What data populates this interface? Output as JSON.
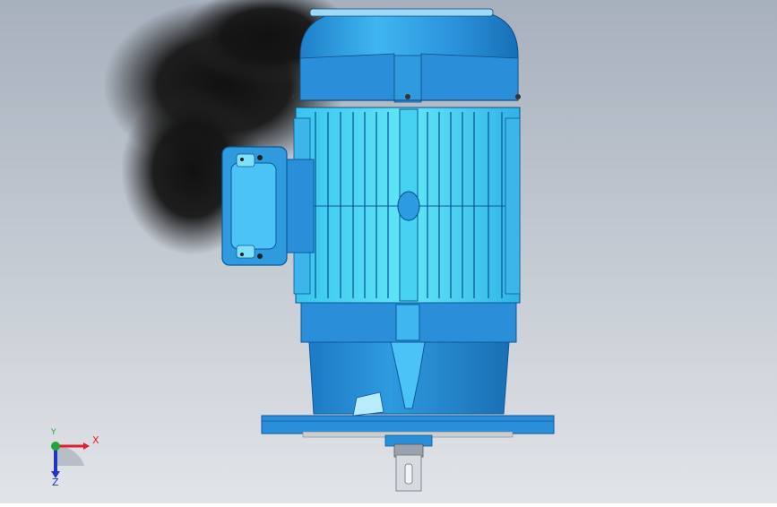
{
  "viewport": {
    "colors": {
      "background_top": "#a9b2bf",
      "background_bottom": "#dfe3e7",
      "shadow": "#161616",
      "motor_body": "#2a8fd8",
      "motor_light": "#4cc3f6",
      "motor_dark": "#0b5a9a",
      "fin_light": "#59e0f4",
      "shaft": "#c9ced3"
    },
    "model": {
      "name": "motor-3d-model"
    }
  },
  "triad": {
    "x_label": "X",
    "y_label": "Y",
    "z_label": "Z",
    "x_color": "#e0202a",
    "y_color": "#1ea83a",
    "z_color": "#2034c8"
  }
}
